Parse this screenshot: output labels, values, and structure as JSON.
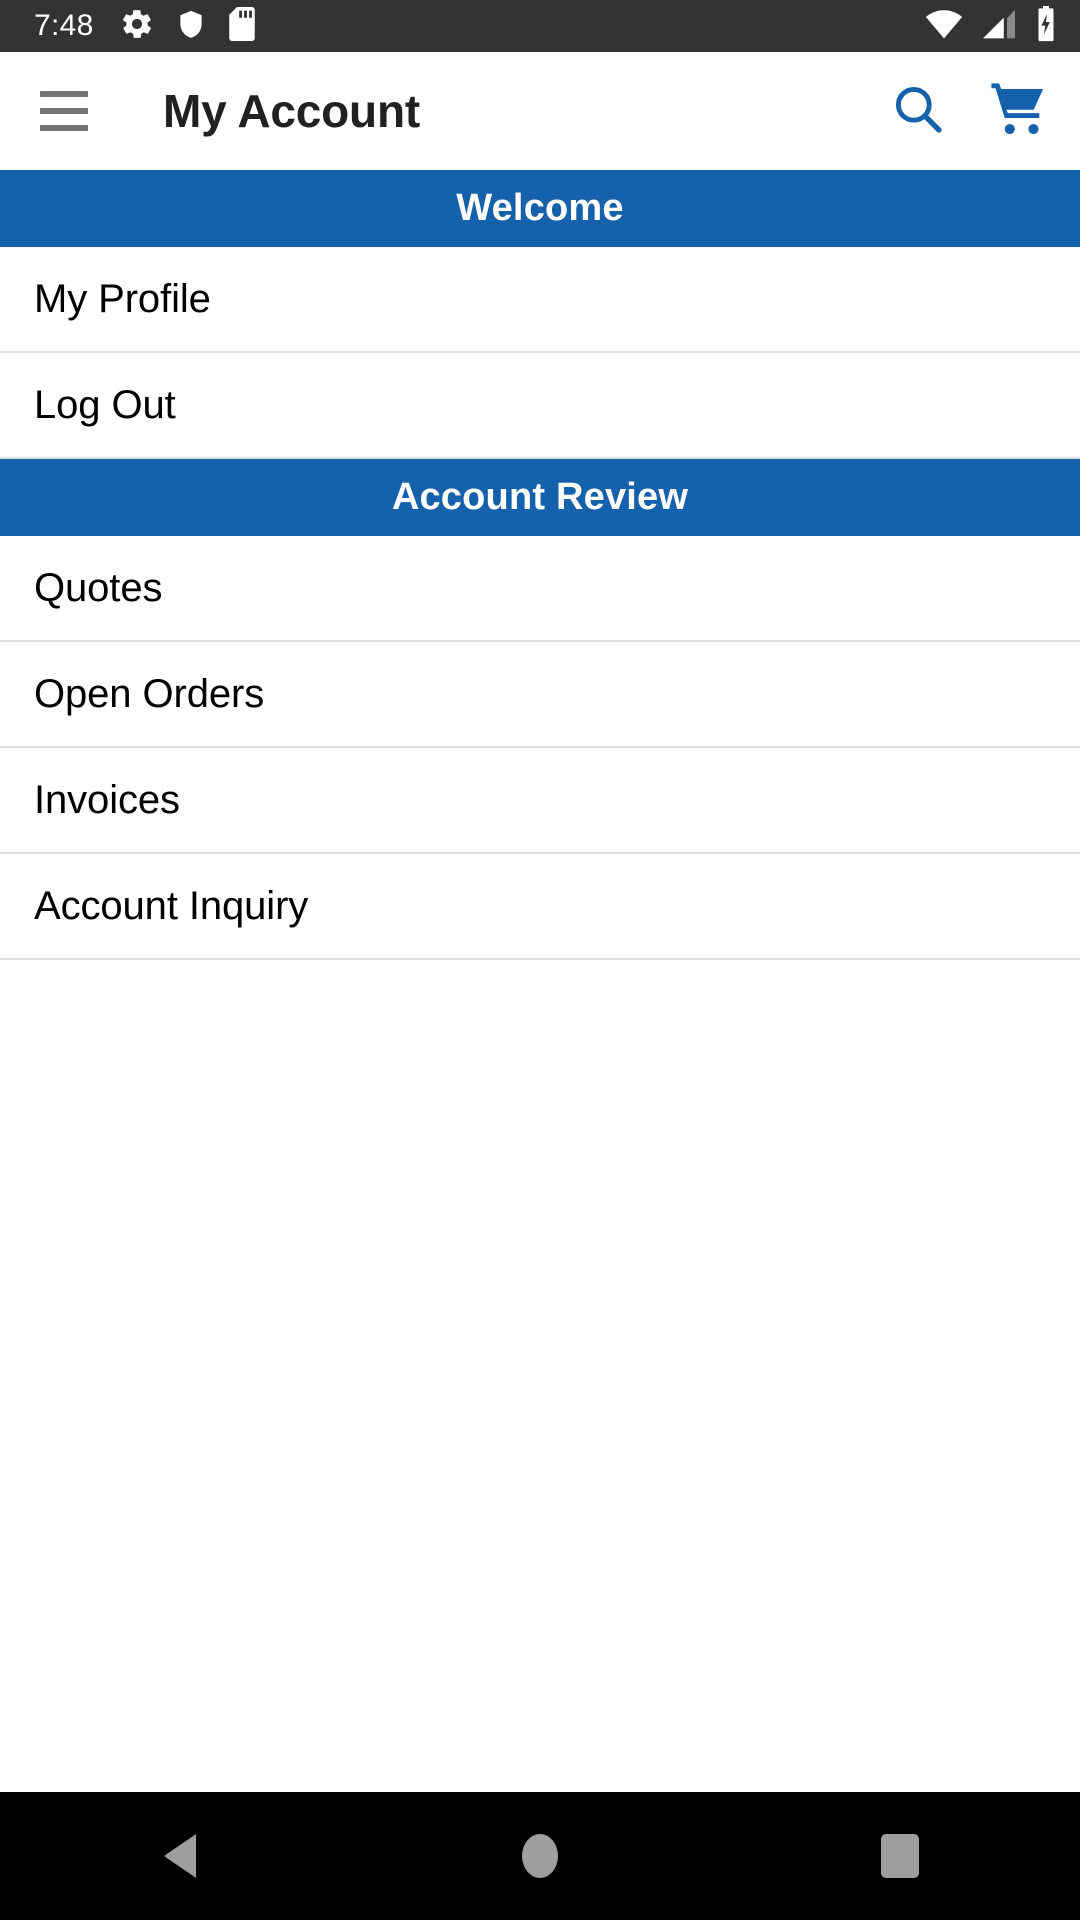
{
  "status_bar": {
    "time": "7:48",
    "left_icons": [
      "gear-icon",
      "shield-icon",
      "sd-card-icon"
    ],
    "right_icons": [
      "wifi-icon",
      "cellular-signal-icon",
      "battery-charging-icon"
    ],
    "background_color": "#333333",
    "foreground_color": "#ffffff"
  },
  "app_bar": {
    "menu_icon": "hamburger-menu-icon",
    "title": "My Account",
    "actions": [
      {
        "icon": "search-icon",
        "name": "search"
      },
      {
        "icon": "shopping-cart-icon",
        "name": "cart"
      }
    ],
    "accent_color": "#1661AB",
    "title_color": "#212121"
  },
  "sections": [
    {
      "header": "Welcome",
      "items": [
        {
          "label": "My Profile"
        },
        {
          "label": "Log Out"
        }
      ]
    },
    {
      "header": "Account Review",
      "items": [
        {
          "label": "Quotes"
        },
        {
          "label": "Open Orders"
        },
        {
          "label": "Invoices"
        },
        {
          "label": "Account Inquiry"
        }
      ]
    }
  ],
  "theme": {
    "section_header_bg": "#1661AB",
    "section_header_text": "#ffffff",
    "divider_color": "#dedede",
    "list_bg": "#ffffff",
    "list_text": "#000000"
  },
  "nav_bar": {
    "background_color": "#000000",
    "glyph_color": "#9e9e9e",
    "buttons": [
      {
        "icon": "back-triangle-icon",
        "name": "back"
      },
      {
        "icon": "home-circle-icon",
        "name": "home"
      },
      {
        "icon": "recents-square-icon",
        "name": "recents"
      }
    ]
  }
}
